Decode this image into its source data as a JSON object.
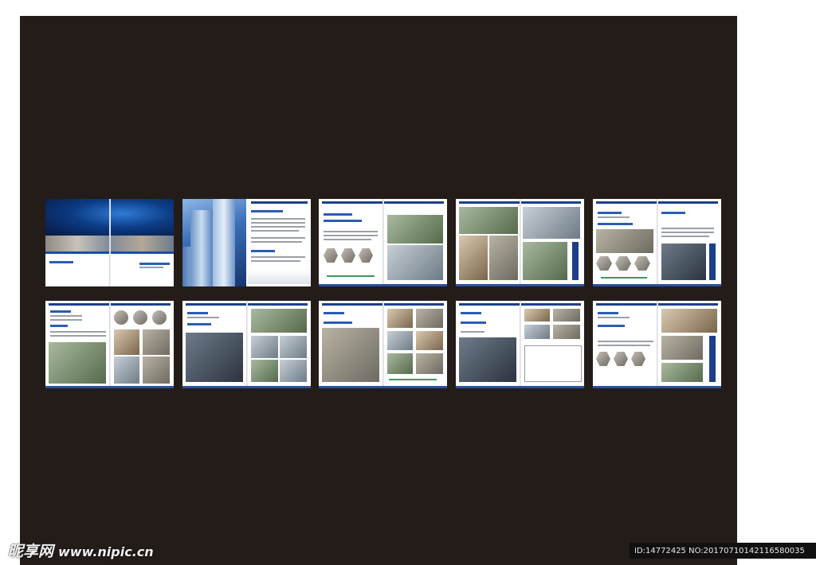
{
  "watermark": {
    "logo_text": "昵享网",
    "url": "www.nipic.cn",
    "image_id": "ID:14772425 NO:20170710142116580035"
  },
  "colors": {
    "board": "#241c19",
    "accent_blue": "#1c3f8a"
  },
  "brochure": {
    "pages": [
      {
        "kind": "cover"
      },
      {
        "kind": "intro"
      },
      {
        "kind": "photo-grid"
      },
      {
        "kind": "photo-grid"
      },
      {
        "kind": "photo-grid"
      },
      {
        "kind": "photo-grid"
      },
      {
        "kind": "photo-grid"
      },
      {
        "kind": "photo-grid"
      },
      {
        "kind": "photo-grid"
      },
      {
        "kind": "photo-grid"
      }
    ]
  }
}
